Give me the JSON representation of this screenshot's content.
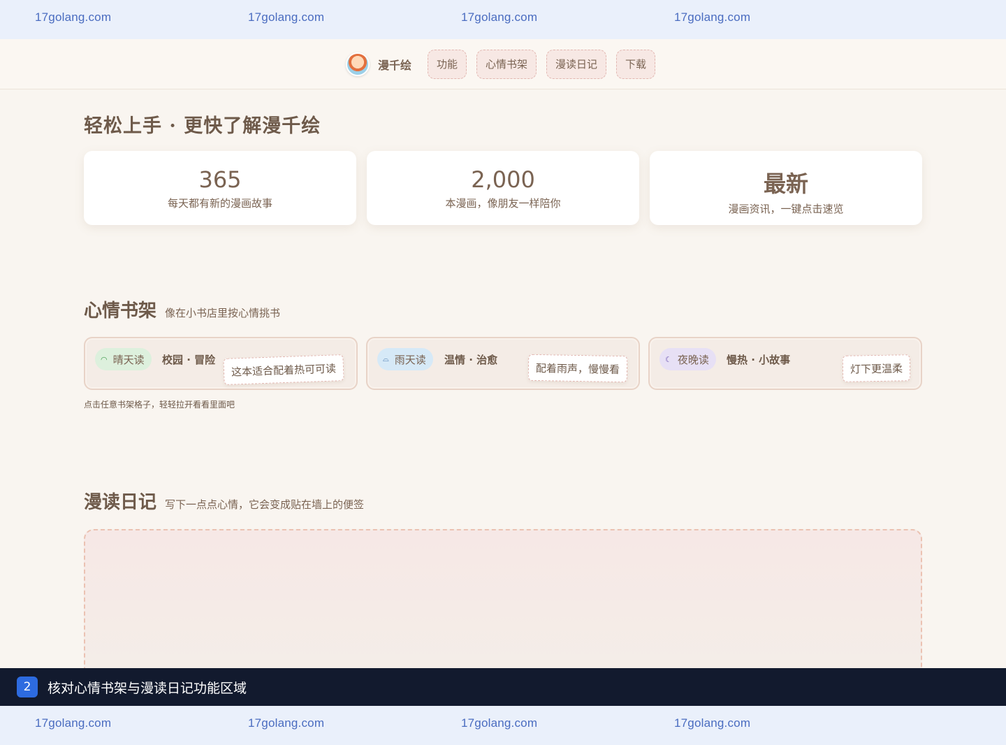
{
  "watermark": {
    "text": "17golang.com"
  },
  "nav": {
    "brand": "漫千绘",
    "items": [
      "功能",
      "心情书架",
      "漫读日记",
      "下载"
    ]
  },
  "intro": {
    "title": "轻松上手 · 更快了解漫千绘",
    "stats": [
      {
        "value": "365",
        "desc": "每天都有新的漫画故事"
      },
      {
        "value": "2,000",
        "desc": "本漫画，像朋友一样陪你"
      },
      {
        "value": "最新",
        "desc": "漫画资讯，一键点击速览"
      }
    ]
  },
  "mood_shelf": {
    "title": "心情书架",
    "subtitle": "像在小书店里按心情挑书",
    "shelves": [
      {
        "chip": "晴天读",
        "tags": "校园 · 冒险",
        "note": "这本适合配着热可可读",
        "icon": "sun-icon",
        "color": "#3f9a4e"
      },
      {
        "chip": "雨天读",
        "tags": "温情 · 治愈",
        "note": "配着雨声，慢慢看",
        "icon": "rain-icon",
        "color": "#4a7ab0"
      },
      {
        "chip": "夜晚读",
        "tags": "慢热 · 小故事",
        "note": "灯下更温柔",
        "icon": "moon-icon",
        "color": "#6d56b0"
      }
    ],
    "hint": "点击任意书架格子，轻轻拉开看看里面吧"
  },
  "diary": {
    "title": "漫读日记",
    "subtitle": "写下一点点心情，它会变成贴在墙上的便签"
  },
  "status": {
    "step": "2",
    "text": "核对心情书架与漫读日记功能区域"
  }
}
